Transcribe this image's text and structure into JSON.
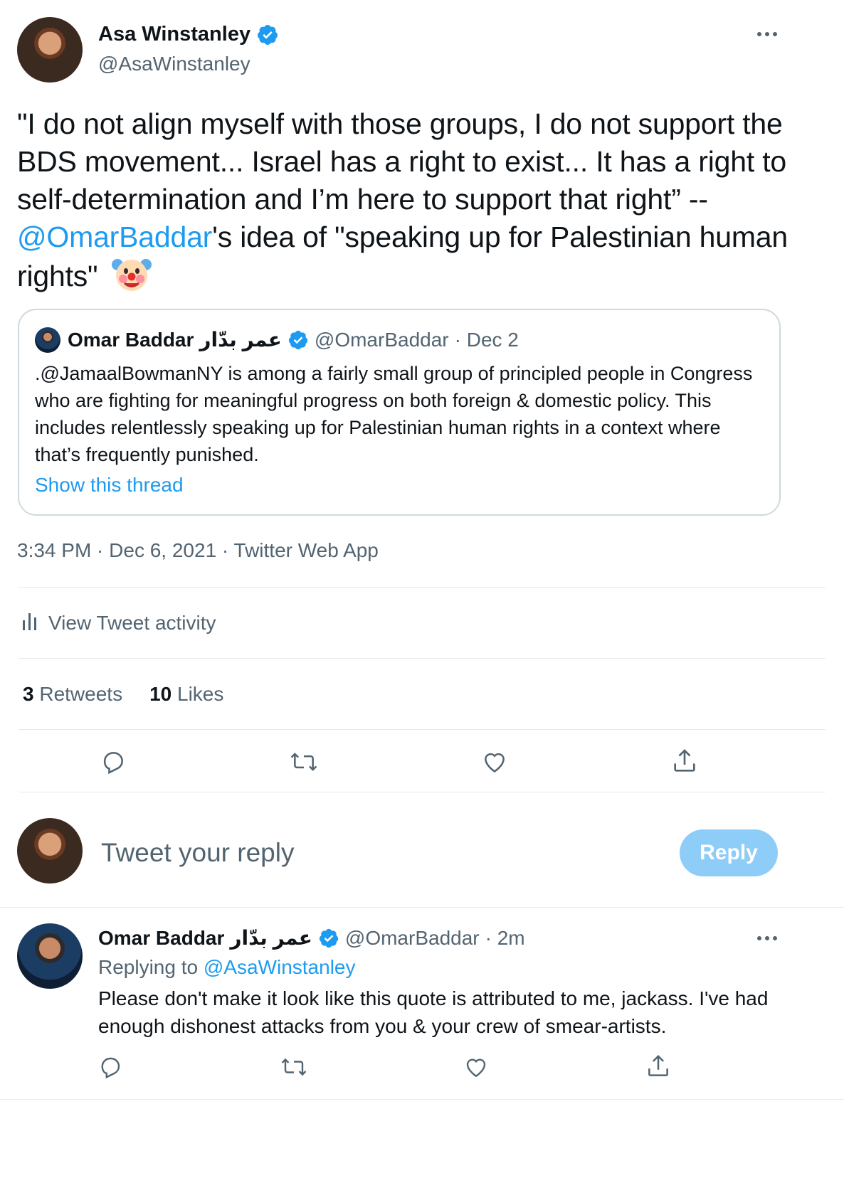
{
  "main_tweet": {
    "author_name": "Asa Winstanley",
    "author_handle": "@AsaWinstanley",
    "text_part1": "\"I do not align myself with those groups, I do not support the BDS movement... Israel has a right to exist... It has a right to self-determination and I’m here to support that right” -- ",
    "mention": "@OmarBaddar",
    "text_part2": "'s idea of \"speaking up for Palestinian human rights\"",
    "emoji": "clown-face",
    "timestamp": "3:34 PM · Dec 6, 2021 · Twitter Web App",
    "activity_label": "View Tweet activity",
    "retweets_count": "3",
    "retweets_label": "Retweets",
    "likes_count": "10",
    "likes_label": "Likes"
  },
  "quoted_tweet": {
    "author_name": "Omar Baddar",
    "author_name_arabic": "عمر بدّار",
    "author_handle": "@OmarBaddar",
    "date": "· Dec 2",
    "text": ".@JamaalBowmanNY is among a fairly small group of principled people in Congress who are fighting for meaningful progress on both foreign & domestic policy. This includes relentlessly speaking up for Palestinian human rights in a context where that’s frequently punished.",
    "show_thread": "Show this thread"
  },
  "compose": {
    "placeholder": "Tweet your reply",
    "reply_button": "Reply"
  },
  "reply_tweet": {
    "author_name": "Omar Baddar",
    "author_name_arabic": "عمر بدّار",
    "author_handle": "@OmarBaddar",
    "time": "· 2m",
    "replying_to_label": "Replying to",
    "replying_to_handle": "@AsaWinstanley",
    "text": "Please don't make it look like this quote is attributed to me, jackass. I've had enough dishonest attacks from you & your crew of smear-artists."
  },
  "colors": {
    "link": "#1d9bf0",
    "muted": "#536471",
    "reply_button": "#8ecdf8",
    "verified": "#1d9bf0"
  },
  "icons": [
    "more-icon",
    "verified-icon",
    "clown-icon",
    "activity-icon",
    "reply-icon",
    "retweet-icon",
    "like-icon",
    "share-icon"
  ]
}
